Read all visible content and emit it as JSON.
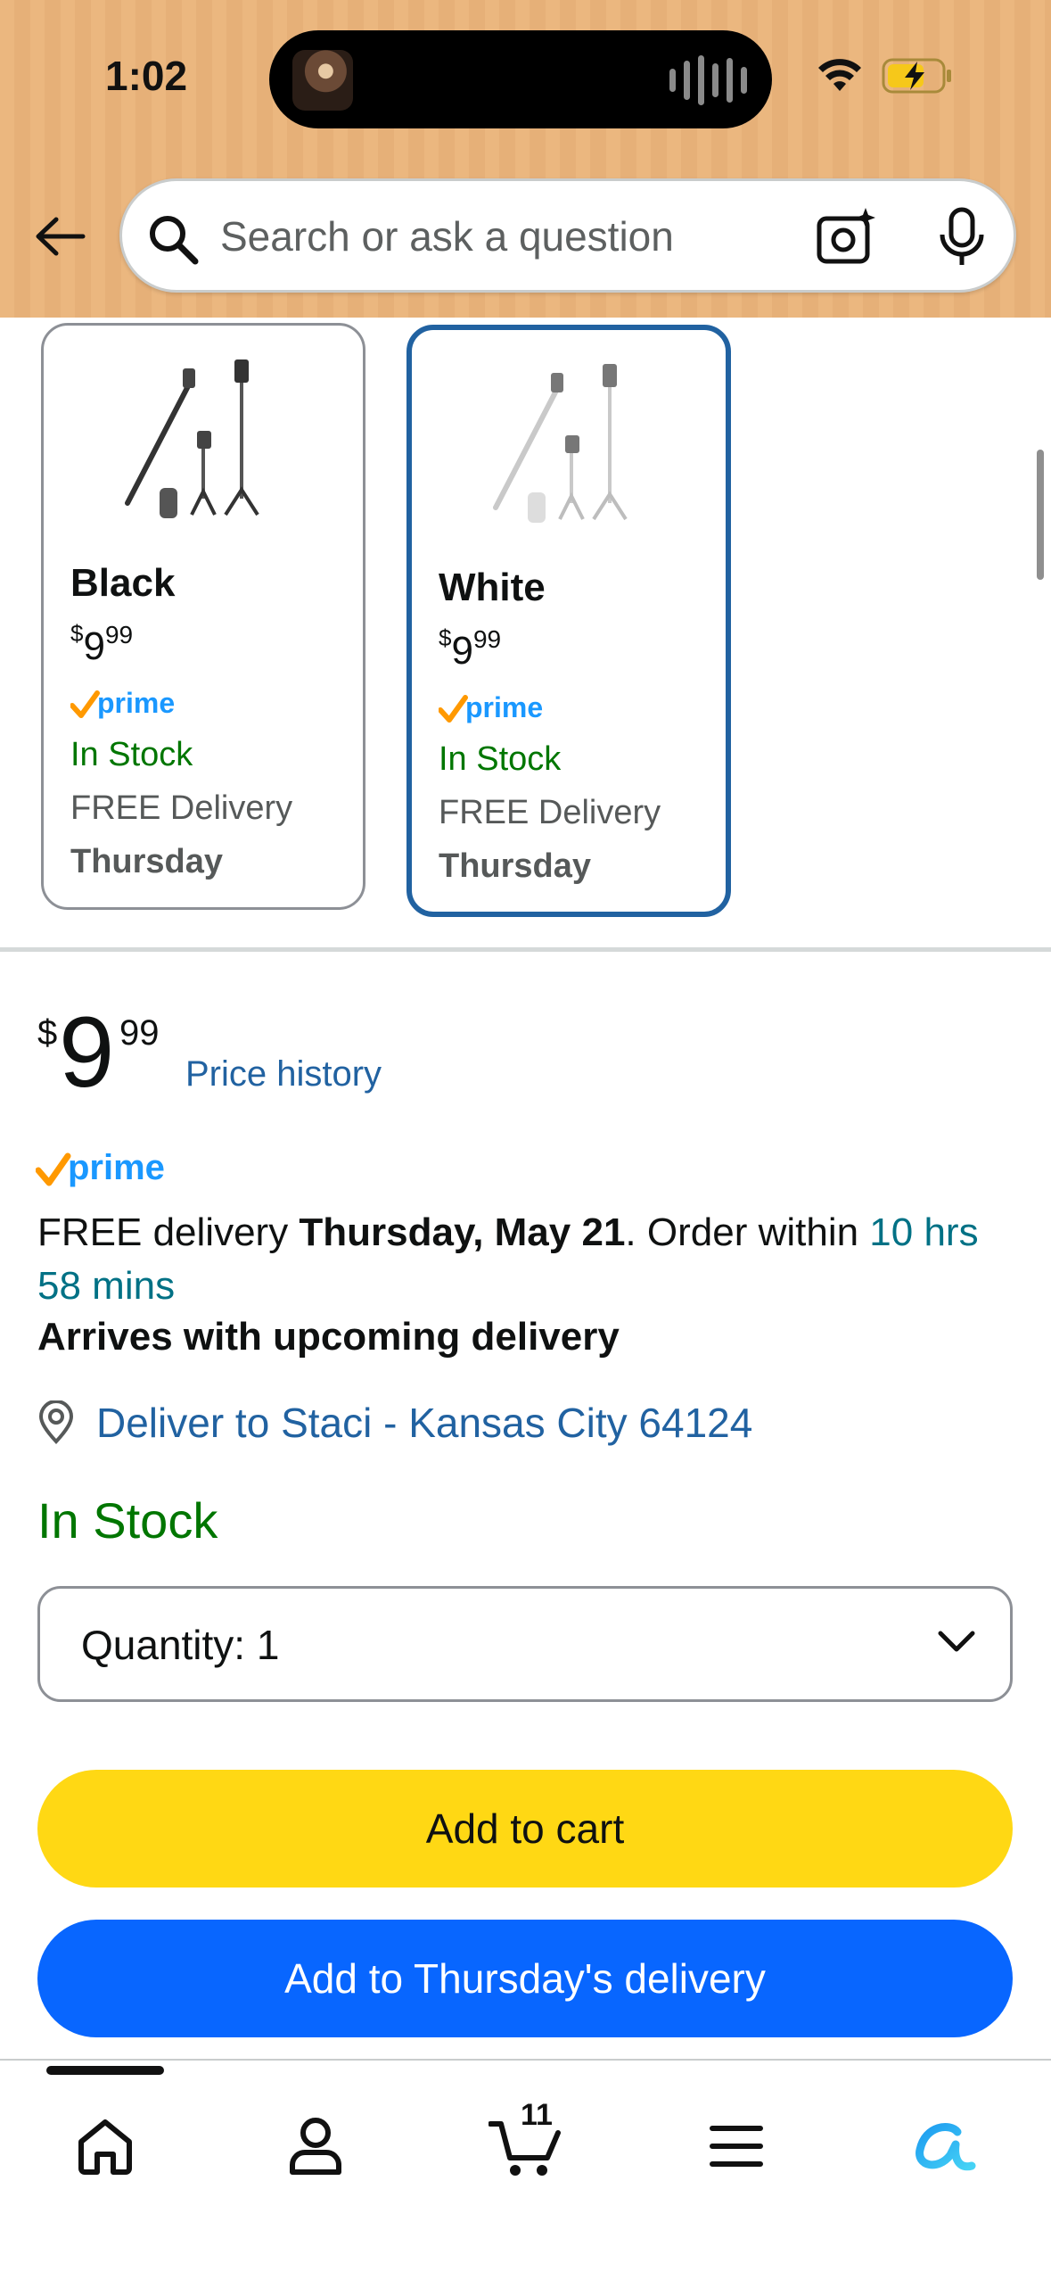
{
  "status_bar": {
    "time": "1:02"
  },
  "search": {
    "placeholder": "Search or ask a question"
  },
  "variants": [
    {
      "name": "Black",
      "price_dollars": "9",
      "price_cents": "99",
      "currency": "$",
      "prime": "prime",
      "stock": "In Stock",
      "delivery": "FREE Delivery",
      "day": "Thursday",
      "selected": false
    },
    {
      "name": "White",
      "price_dollars": "9",
      "price_cents": "99",
      "currency": "$",
      "prime": "prime",
      "stock": "In Stock",
      "delivery": "FREE Delivery",
      "day": "Thursday",
      "selected": true
    }
  ],
  "buybox": {
    "currency": "$",
    "price_dollars": "9",
    "price_cents": "99",
    "price_history": "Price history",
    "prime": "prime",
    "delivery_prefix": "FREE delivery ",
    "delivery_date": "Thursday, May 21",
    "order_within": ". Order within ",
    "countdown": "10 hrs 58 mins",
    "arrives": "Arrives with upcoming delivery",
    "deliver_to": "Deliver to Staci - Kansas City 64124",
    "stock": "In Stock",
    "quantity_label": "Quantity:",
    "quantity_value": "1",
    "add_to_cart": "Add to cart",
    "add_to_day": "Add to Thursday's delivery"
  },
  "bottom_nav": {
    "items": [
      "home-icon",
      "account-icon",
      "cart-icon",
      "menu-icon",
      "rufus-icon"
    ],
    "cart_count": "11"
  },
  "colors": {
    "header_bg": "#ebb77f",
    "link_blue": "#2162a1",
    "stock_green": "#007600",
    "cart_yellow": "#ffd814",
    "buy_blue": "#0866ff",
    "prime_blue": "#1a98ff",
    "prime_check": "#ff9900"
  }
}
